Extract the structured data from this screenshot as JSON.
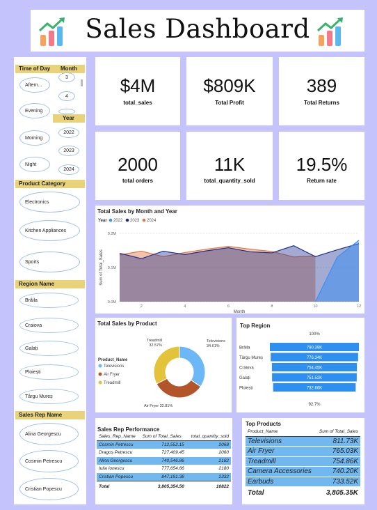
{
  "header": {
    "title": "Sales Dashboard",
    "left_icon": "bar-chart-trend-icon",
    "right_icon": "bar-chart-trend-icon"
  },
  "filters": {
    "time_of_day": {
      "title": "Time of Day",
      "options": [
        "Aftern...",
        "Evening",
        "Morning",
        "Night"
      ]
    },
    "month": {
      "title": "Month",
      "options": [
        "3",
        "4",
        "5"
      ]
    },
    "year": {
      "title": "Year",
      "options": [
        "2022",
        "2023",
        "2024"
      ]
    },
    "product_category": {
      "title": "Product Category",
      "options": [
        "Electronics",
        "Kitchen Appliances",
        "Sports"
      ]
    },
    "region_name": {
      "title": "Region Name",
      "options": [
        "Brăila",
        "Craiova",
        "Galați",
        "Ploiești",
        "Târgu Mureș"
      ]
    },
    "sales_rep_name": {
      "title": "Sales Rep Name",
      "options": [
        "Alina Georgescu",
        "Cosmin Petrescu",
        "Cristian Popescu"
      ]
    }
  },
  "kpis": [
    {
      "value": "$4M",
      "label": "total_sales"
    },
    {
      "value": "$809K",
      "label": "Total Profit"
    },
    {
      "value": "389",
      "label": "Total Returns"
    },
    {
      "value": "2000",
      "label": "total orders"
    },
    {
      "value": "11K",
      "label": "total_quantity_sold"
    },
    {
      "value": "19.5%",
      "label": "Return rate"
    }
  ],
  "colors": {
    "y2022": "#3d8ff0",
    "y2023": "#1c2d8f",
    "y2024": "#e07846",
    "accent": "#72b8f0",
    "gold": "#e8d27a",
    "funnel": "#2d8fef",
    "donut_tv": "#6cb8f6",
    "donut_af": "#b3552a",
    "donut_tm": "#e3c33a"
  },
  "chart_data": [
    {
      "type": "area",
      "title": "Total Sales by Month and Year",
      "legend_title": "Year",
      "legend_position": "top-left",
      "xlabel": "Month",
      "ylabel": "Sum of Total_Sales",
      "ylim": [
        0,
        0.2
      ],
      "y_ticks": [
        "0.0M",
        "0.1M",
        "0.2M"
      ],
      "y_tick_values": [
        0,
        0.1,
        0.2
      ],
      "x_ticks": [
        "2",
        "4",
        "6",
        "8",
        "10",
        "12"
      ],
      "x_tick_values": [
        2,
        4,
        6,
        8,
        10,
        12
      ],
      "xlim": [
        1,
        12
      ],
      "series": [
        {
          "name": "2022",
          "x": [
            10,
            11,
            12
          ],
          "values": [
            0.0,
            0.13,
            0.18
          ]
        },
        {
          "name": "2023",
          "x": [
            1,
            2,
            3,
            4,
            5,
            6,
            7,
            8,
            9,
            10,
            11,
            12
          ],
          "values": [
            0.142,
            0.126,
            0.148,
            0.138,
            0.149,
            0.158,
            0.146,
            0.143,
            0.164,
            0.132,
            0.152,
            0.17
          ]
        },
        {
          "name": "2024",
          "x": [
            1,
            2,
            3,
            4,
            5,
            6,
            7,
            8,
            9,
            10
          ],
          "values": [
            0.137,
            0.148,
            0.132,
            0.144,
            0.154,
            0.162,
            0.154,
            0.147,
            0.131,
            0.134
          ]
        }
      ]
    },
    {
      "type": "pie",
      "title": "Total Sales by Product",
      "legend_title": "Product_Name",
      "legend_position": "left",
      "categories": [
        "Televisions",
        "Air Fryer",
        "Treadmill"
      ],
      "values": [
        34.61,
        32.81,
        32.57
      ],
      "labels": [
        "Televisions 34.61%",
        "Air Fryer 32.81%",
        "Treadmill 32.57%"
      ]
    },
    {
      "type": "bar",
      "title": "Top Region",
      "orientation": "horizontal",
      "top_label": "100%",
      "bottom_label": "92.7%",
      "categories": [
        "Brăila",
        "Târgu Mureș",
        "Craiova",
        "Galați",
        "Ploiești"
      ],
      "values": [
        790.39,
        776.34,
        754.45,
        751.52,
        732.66
      ],
      "value_labels": [
        "790.39K",
        "776.34K",
        "754.45K",
        "751.52K",
        "732.66K"
      ]
    },
    {
      "type": "table",
      "title": "Sales Rep Performance",
      "columns": [
        "Sales_Rep_Name",
        "Sum of Total_Sales",
        "total_quantity_sold"
      ],
      "rows": [
        [
          "Cosmin Petrescu",
          "712,552.15",
          "2068"
        ],
        [
          "Dragoș Petrescu",
          "727,409.45",
          "2060"
        ],
        [
          "Alina Georgescu",
          "740,546.86",
          "2182"
        ],
        [
          "Iulia Ionescu",
          "777,654.66",
          "2180"
        ],
        [
          "Cristian Popescu",
          "847,191.38",
          "2332"
        ]
      ],
      "total": [
        "Total",
        "3,805,354.50",
        "10822"
      ]
    },
    {
      "type": "table",
      "title": "Top Products",
      "columns": [
        "Product_Name",
        "Sum of Total_Sales"
      ],
      "rows": [
        [
          "Televisions",
          "811.73K"
        ],
        [
          "Air Fryer",
          "765.03K"
        ],
        [
          "Treadmill",
          "754.86K"
        ],
        [
          "Camera Accessories",
          "740.20K"
        ],
        [
          "Earbuds",
          "733.52K"
        ]
      ],
      "total": [
        "Total",
        "3,805.35K"
      ]
    }
  ]
}
